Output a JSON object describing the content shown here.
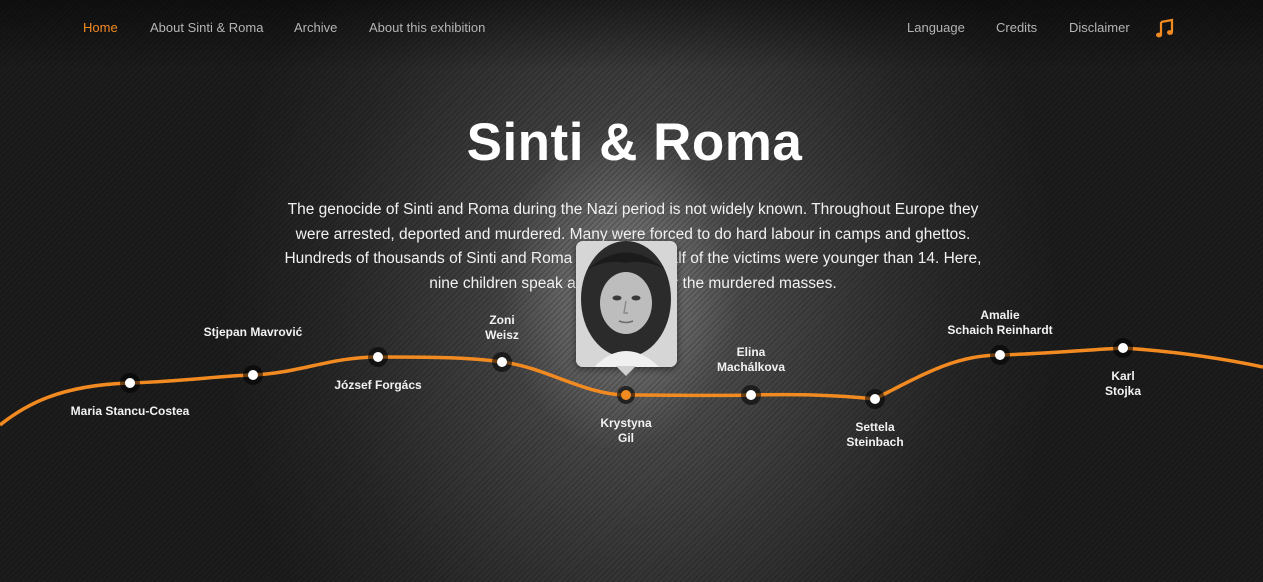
{
  "nav": {
    "left": [
      "Home",
      "About Sinti & Roma",
      "Archive",
      "About this exhibition"
    ],
    "right": [
      "Language",
      "Credits",
      "Disclaimer"
    ],
    "active": "Home",
    "music_icon": "music-note-icon"
  },
  "hero": {
    "title": "Sinti & Roma",
    "intro": "The genocide of Sinti and Roma during the Nazi period is not widely known. Throughout Europe they were arrested, deported and murdered. Many were forced to do hard labour in camps and ghettos. Hundreds of thousands of Sinti and Roma were killed. Half of the victims were younger than 14. Here, nine children speak as witnesses for the murdered masses."
  },
  "timeline": {
    "children": [
      {
        "name": "Maria Stancu-Costea"
      },
      {
        "name": "Stjepan Mavrović"
      },
      {
        "name": "József Forgács"
      },
      {
        "name": "Zoni\nWeisz"
      },
      {
        "name": "Krystyna\nGil",
        "active": true
      },
      {
        "name": "Elina\nMachálkova"
      },
      {
        "name": "Settela\nSteinbach"
      },
      {
        "name": "Amalie\nSchaich Reinhardt"
      },
      {
        "name": "Karl\nStojka"
      }
    ]
  },
  "colors": {
    "accent": "#f28a22",
    "nav_text": "#b4b4b4",
    "text": "#ffffff"
  }
}
